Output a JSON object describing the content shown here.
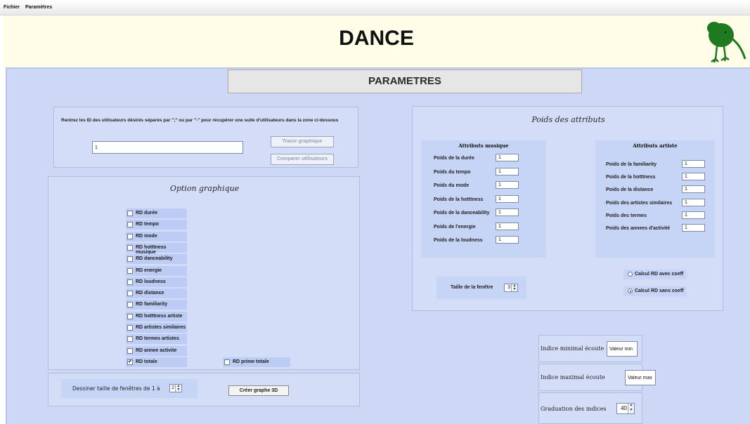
{
  "menu": {
    "file": "Fichier",
    "params": "Paramètres"
  },
  "header": {
    "title": "DANCE",
    "logo_icon": "kiwi-bird-icon",
    "logo_color": "#1f7a1f"
  },
  "params_title": "PARAMETRES",
  "users": {
    "instruction": "Rentrez les ID des utilisateurs désirés séparés par \";\" ou par \"-\" pour récupérer une suite d'utilisateurs dans la zone ci-dessous",
    "input_value": "1",
    "trace_button": "Tracer graphique",
    "compare_button": "Comparer utilisateurs"
  },
  "graph_options": {
    "title": "Option graphique",
    "checkboxes": [
      {
        "label": "RD durée",
        "checked": false
      },
      {
        "label": "RD tempo",
        "checked": false
      },
      {
        "label": "RD mode",
        "checked": false
      },
      {
        "label": "RD hotttness musique",
        "checked": false
      },
      {
        "label": "RD danceability",
        "checked": false
      },
      {
        "label": "RD energie",
        "checked": false
      },
      {
        "label": "RD loudness",
        "checked": false
      },
      {
        "label": "RD distance",
        "checked": false
      },
      {
        "label": "RD familiarity",
        "checked": false
      },
      {
        "label": "RD hotttness artiste",
        "checked": false
      },
      {
        "label": "RD artistes similaires",
        "checked": false
      },
      {
        "label": "RD termes artistes",
        "checked": false
      },
      {
        "label": "RD annee activite",
        "checked": false
      },
      {
        "label": "RD totale",
        "checked": true
      }
    ],
    "prime_total": {
      "label": "RD prime totale",
      "checked": false
    }
  },
  "graph3d": {
    "label": "Dessiner taille de fenêtres de 1 à",
    "value": "2",
    "button": "Créer graphe 3D"
  },
  "weights": {
    "title": "Poids des attributs",
    "music": {
      "title": "Attributs musique",
      "items": [
        {
          "label": "Poids de la durée",
          "value": "1"
        },
        {
          "label": "Poids du tempo",
          "value": "1"
        },
        {
          "label": "Poids du mode",
          "value": "1"
        },
        {
          "label": "Poids de la hotttness",
          "value": "1"
        },
        {
          "label": "Poids de la danceability",
          "value": "1"
        },
        {
          "label": "Poids de l'energie",
          "value": "1"
        },
        {
          "label": "Poids de la loudness",
          "value": "1"
        }
      ]
    },
    "artist": {
      "title": "Attributs artiste",
      "items": [
        {
          "label": "Poids de la familiarity",
          "value": "1"
        },
        {
          "label": "Poids de la hotttness",
          "value": "1"
        },
        {
          "label": "Poids de la distance",
          "value": "1"
        },
        {
          "label": "Poids des artistes similaires",
          "value": "1"
        },
        {
          "label": "Poids des termes",
          "value": "1"
        },
        {
          "label": "Poids des annees d'activité",
          "value": "1"
        }
      ]
    },
    "window_size": {
      "label": "Taille de la fenêtre",
      "value": "3"
    },
    "radio_with": {
      "label": "Calcul RD avec coeff",
      "selected": false
    },
    "radio_without": {
      "label": "Calcul RD sans coeff",
      "selected": true
    }
  },
  "indices": {
    "min_label": "Indice minimal écoute",
    "min_value": "Valeur min",
    "max_label": "Indice maximal écoute",
    "max_value": "Valeur max",
    "grad_label": "Graduation des indices",
    "grad_value": "40"
  }
}
